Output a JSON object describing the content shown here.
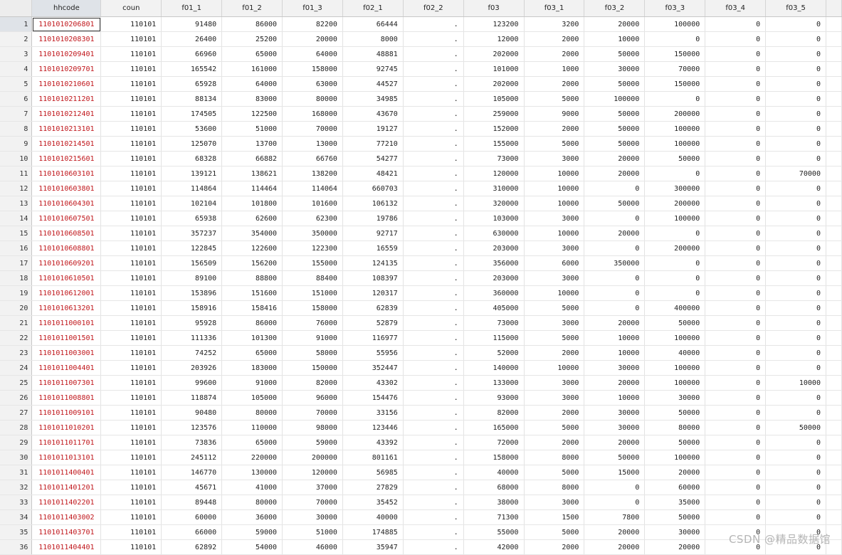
{
  "columns": [
    "hhcode",
    "coun",
    "f01_1",
    "f01_2",
    "f01_3",
    "f02_1",
    "f02_2",
    "f03",
    "f03_1",
    "f03_2",
    "f03_3",
    "f03_4",
    "f03_5"
  ],
  "rows": [
    [
      "1101010206801",
      "110101",
      "91480",
      "86000",
      "82200",
      "66444",
      ".",
      "123200",
      "3200",
      "20000",
      "100000",
      "0",
      "0"
    ],
    [
      "1101010208301",
      "110101",
      "26400",
      "25200",
      "20000",
      "8000",
      ".",
      "12000",
      "2000",
      "10000",
      "0",
      "0",
      "0"
    ],
    [
      "1101010209401",
      "110101",
      "66960",
      "65000",
      "64000",
      "48881",
      ".",
      "202000",
      "2000",
      "50000",
      "150000",
      "0",
      "0"
    ],
    [
      "1101010209701",
      "110101",
      "165542",
      "161000",
      "158000",
      "92745",
      ".",
      "101000",
      "1000",
      "30000",
      "70000",
      "0",
      "0"
    ],
    [
      "1101010210601",
      "110101",
      "65928",
      "64000",
      "63000",
      "44527",
      ".",
      "202000",
      "2000",
      "50000",
      "150000",
      "0",
      "0"
    ],
    [
      "1101010211201",
      "110101",
      "88134",
      "83000",
      "80000",
      "34985",
      ".",
      "105000",
      "5000",
      "100000",
      "0",
      "0",
      "0"
    ],
    [
      "1101010212401",
      "110101",
      "174505",
      "122500",
      "168000",
      "43670",
      ".",
      "259000",
      "9000",
      "50000",
      "200000",
      "0",
      "0"
    ],
    [
      "1101010213101",
      "110101",
      "53600",
      "51000",
      "70000",
      "19127",
      ".",
      "152000",
      "2000",
      "50000",
      "100000",
      "0",
      "0"
    ],
    [
      "1101010214501",
      "110101",
      "125070",
      "13700",
      "13000",
      "77210",
      ".",
      "155000",
      "5000",
      "50000",
      "100000",
      "0",
      "0"
    ],
    [
      "1101010215601",
      "110101",
      "68328",
      "66882",
      "66760",
      "54277",
      ".",
      "73000",
      "3000",
      "20000",
      "50000",
      "0",
      "0"
    ],
    [
      "1101010603101",
      "110101",
      "139121",
      "138621",
      "138200",
      "48421",
      ".",
      "120000",
      "10000",
      "20000",
      "0",
      "0",
      "70000"
    ],
    [
      "1101010603801",
      "110101",
      "114864",
      "114464",
      "114064",
      "660703",
      ".",
      "310000",
      "10000",
      "0",
      "300000",
      "0",
      "0"
    ],
    [
      "1101010604301",
      "110101",
      "102104",
      "101800",
      "101600",
      "106132",
      ".",
      "320000",
      "10000",
      "50000",
      "200000",
      "0",
      "0"
    ],
    [
      "1101010607501",
      "110101",
      "65938",
      "62600",
      "62300",
      "19786",
      ".",
      "103000",
      "3000",
      "0",
      "100000",
      "0",
      "0"
    ],
    [
      "1101010608501",
      "110101",
      "357237",
      "354000",
      "350000",
      "92717",
      ".",
      "630000",
      "10000",
      "20000",
      "0",
      "0",
      "0"
    ],
    [
      "1101010608801",
      "110101",
      "122845",
      "122600",
      "122300",
      "16559",
      ".",
      "203000",
      "3000",
      "0",
      "200000",
      "0",
      "0"
    ],
    [
      "1101010609201",
      "110101",
      "156509",
      "156200",
      "155000",
      "124135",
      ".",
      "356000",
      "6000",
      "350000",
      "0",
      "0",
      "0"
    ],
    [
      "1101010610501",
      "110101",
      "89100",
      "88800",
      "88400",
      "108397",
      ".",
      "203000",
      "3000",
      "0",
      "0",
      "0",
      "0"
    ],
    [
      "1101010612001",
      "110101",
      "153896",
      "151600",
      "151000",
      "120317",
      ".",
      "360000",
      "10000",
      "0",
      "0",
      "0",
      "0"
    ],
    [
      "1101010613201",
      "110101",
      "158916",
      "158416",
      "158000",
      "62839",
      ".",
      "405000",
      "5000",
      "0",
      "400000",
      "0",
      "0"
    ],
    [
      "1101011000101",
      "110101",
      "95928",
      "86000",
      "76000",
      "52879",
      ".",
      "73000",
      "3000",
      "20000",
      "50000",
      "0",
      "0"
    ],
    [
      "1101011001501",
      "110101",
      "111336",
      "101300",
      "91000",
      "116977",
      ".",
      "115000",
      "5000",
      "10000",
      "100000",
      "0",
      "0"
    ],
    [
      "1101011003001",
      "110101",
      "74252",
      "65000",
      "58000",
      "55956",
      ".",
      "52000",
      "2000",
      "10000",
      "40000",
      "0",
      "0"
    ],
    [
      "1101011004401",
      "110101",
      "203926",
      "183000",
      "150000",
      "352447",
      ".",
      "140000",
      "10000",
      "30000",
      "100000",
      "0",
      "0"
    ],
    [
      "1101011007301",
      "110101",
      "99600",
      "91000",
      "82000",
      "43302",
      ".",
      "133000",
      "3000",
      "20000",
      "100000",
      "0",
      "10000"
    ],
    [
      "1101011008801",
      "110101",
      "118874",
      "105000",
      "96000",
      "154476",
      ".",
      "93000",
      "3000",
      "10000",
      "30000",
      "0",
      "0"
    ],
    [
      "1101011009101",
      "110101",
      "90480",
      "80000",
      "70000",
      "33156",
      ".",
      "82000",
      "2000",
      "30000",
      "50000",
      "0",
      "0"
    ],
    [
      "1101011010201",
      "110101",
      "123576",
      "110000",
      "98000",
      "123446",
      ".",
      "165000",
      "5000",
      "30000",
      "80000",
      "0",
      "50000"
    ],
    [
      "1101011011701",
      "110101",
      "73836",
      "65000",
      "59000",
      "43392",
      ".",
      "72000",
      "2000",
      "20000",
      "50000",
      "0",
      "0"
    ],
    [
      "1101011013101",
      "110101",
      "245112",
      "220000",
      "200000",
      "801161",
      ".",
      "158000",
      "8000",
      "50000",
      "100000",
      "0",
      "0"
    ],
    [
      "1101011400401",
      "110101",
      "146770",
      "130000",
      "120000",
      "56985",
      ".",
      "40000",
      "5000",
      "15000",
      "20000",
      "0",
      "0"
    ],
    [
      "1101011401201",
      "110101",
      "45671",
      "41000",
      "37000",
      "27829",
      ".",
      "68000",
      "8000",
      "0",
      "60000",
      "0",
      "0"
    ],
    [
      "1101011402201",
      "110101",
      "89448",
      "80000",
      "70000",
      "35452",
      ".",
      "38000",
      "3000",
      "0",
      "35000",
      "0",
      "0"
    ],
    [
      "1101011403002",
      "110101",
      "60000",
      "36000",
      "30000",
      "40000",
      ".",
      "71300",
      "1500",
      "7800",
      "50000",
      "0",
      "0"
    ],
    [
      "1101011403701",
      "110101",
      "66000",
      "59000",
      "51000",
      "174885",
      ".",
      "55000",
      "5000",
      "20000",
      "30000",
      "0",
      "0"
    ],
    [
      "1101011404401",
      "110101",
      "62892",
      "54000",
      "46000",
      "35947",
      ".",
      "42000",
      "2000",
      "20000",
      "20000",
      "0",
      "0"
    ]
  ],
  "watermark": "CSDN @精品数据馆"
}
